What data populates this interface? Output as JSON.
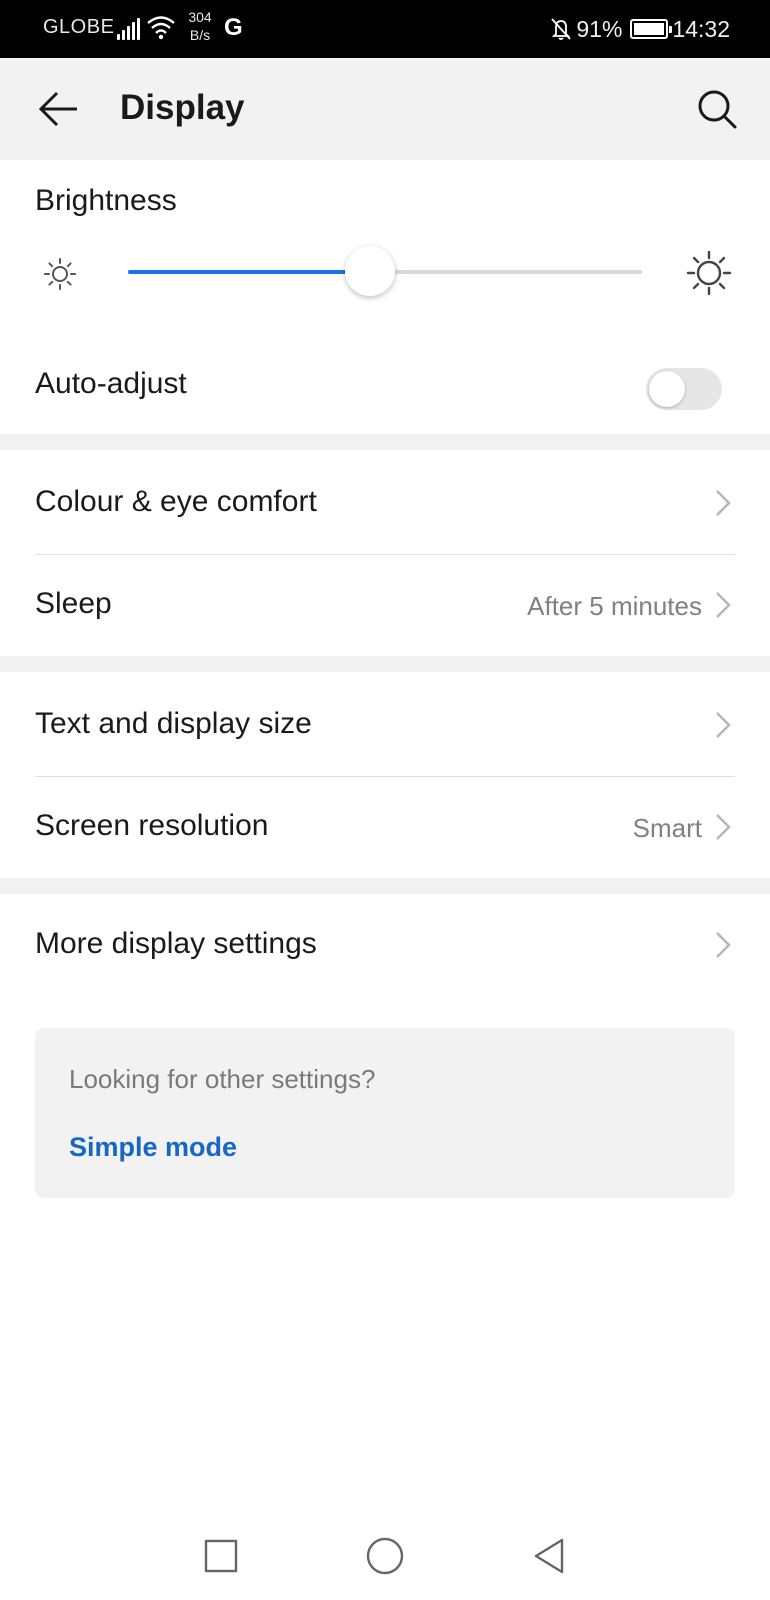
{
  "status_bar": {
    "carrier": "GLOBE",
    "net_speed_value": "304",
    "net_speed_unit": "B/s",
    "network_type": "G",
    "battery_percent": "91%",
    "time": "14:32",
    "icons": [
      "signal-icon",
      "wifi-icon",
      "bell-off-icon",
      "battery-icon"
    ]
  },
  "app_bar": {
    "title": "Display",
    "back_icon": "arrow-left-icon",
    "search_icon": "search-icon"
  },
  "brightness": {
    "label": "Brightness",
    "level": 0.47,
    "accent_color": "#1a73e8",
    "low_icon": "sun-small-icon",
    "high_icon": "sun-large-icon"
  },
  "auto_adjust": {
    "label": "Auto-adjust",
    "enabled": false
  },
  "rows": {
    "colour_eye_comfort": {
      "label": "Colour & eye comfort"
    },
    "sleep": {
      "label": "Sleep",
      "value": "After 5 minutes"
    },
    "text_display_size": {
      "label": "Text and display size"
    },
    "screen_resolution": {
      "label": "Screen resolution",
      "value": "Smart"
    },
    "more_display_settings": {
      "label": "More display settings"
    }
  },
  "hint": {
    "text": "Looking for other settings?",
    "link": "Simple mode",
    "link_color": "#1668c4"
  },
  "nav_bar": {
    "icons": [
      "recents-square-icon",
      "home-circle-icon",
      "back-triangle-icon"
    ]
  }
}
